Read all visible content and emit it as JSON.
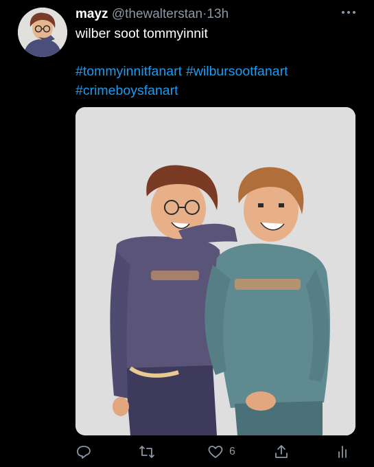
{
  "tweet": {
    "display_name": "mayz",
    "handle": "@thewalterstan",
    "separator": "·",
    "time": "13h",
    "text": "wilber soot tommyinnit",
    "hashtags": [
      "#tommyinnitfanart",
      "#wilbursootfanart",
      "#crimeboysfanart"
    ]
  },
  "actions": {
    "reply_icon": "reply-icon",
    "retweet_icon": "retweet-icon",
    "like_icon": "heart-icon",
    "like_count": "6",
    "share_icon": "share-icon",
    "analytics_icon": "analytics-icon"
  },
  "colors": {
    "background": "#000000",
    "link": "#1d9bf0",
    "muted": "#8b98a5"
  }
}
